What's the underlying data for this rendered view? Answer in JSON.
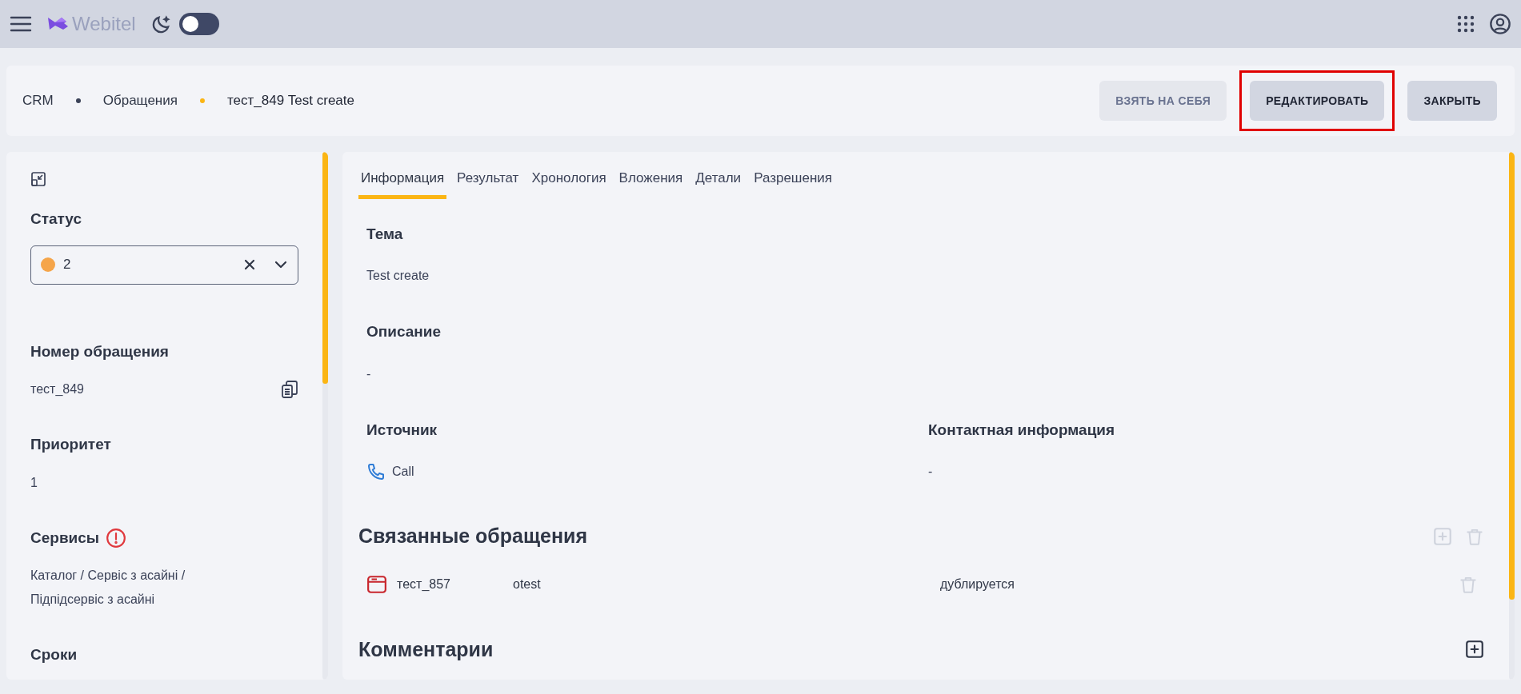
{
  "topbar": {
    "logo": "Webitel",
    "dark_mode": {
      "on": false
    }
  },
  "breadcrumbs": [
    {
      "label": "CRM",
      "selected": false
    },
    {
      "label": "Обращения",
      "selected": false
    },
    {
      "label": "тест_849 Test create",
      "selected": true
    }
  ],
  "actions": [
    {
      "label": "ВЗЯТЬ НА СЕБЯ",
      "disabled": true,
      "highlighted": false
    },
    {
      "label": "РЕДАКТИРОВАТЬ",
      "disabled": false,
      "highlighted": true
    },
    {
      "label": "ЗАКРЫТЬ",
      "disabled": false,
      "highlighted": false
    }
  ],
  "sidebar": {
    "status": {
      "label": "Статус",
      "value": "2",
      "color": "#f5a54a"
    },
    "fields": [
      {
        "kind": "copy",
        "label": "Номер обращения",
        "value": "тест_849"
      },
      {
        "kind": "text",
        "label": "Приоритет",
        "value": "1"
      },
      {
        "kind": "warning",
        "label": "Сервисы",
        "value": "Каталог / Сервіс з асайні / Підпідсервіс з асайні"
      },
      {
        "kind": "text",
        "label": "Сроки"
      }
    ]
  },
  "tabs": [
    {
      "label": "Информация",
      "selected": true
    },
    {
      "label": "Результат",
      "selected": false
    },
    {
      "label": "Хронология",
      "selected": false
    },
    {
      "label": "Вложения",
      "selected": false
    },
    {
      "label": "Детали",
      "selected": false
    },
    {
      "label": "Разрешения",
      "selected": false
    }
  ],
  "info_rows": [
    [
      {
        "kind": "text",
        "label": "Тема",
        "value": "Test create"
      }
    ],
    [
      {
        "kind": "text",
        "label": "Описание",
        "value": "-"
      }
    ],
    [
      {
        "kind": "source",
        "label": "Источник",
        "value": "Call"
      },
      {
        "kind": "text",
        "label": "Контактная информация",
        "value": "-"
      }
    ]
  ],
  "related": {
    "title": "Связанные обращения",
    "actions_disabled": true,
    "items": [
      {
        "number": "тест_857",
        "title": "otest",
        "relation": "дублируется",
        "delete_disabled": true
      }
    ]
  },
  "comments": {
    "title": "Комментарии",
    "add_disabled": false
  }
}
